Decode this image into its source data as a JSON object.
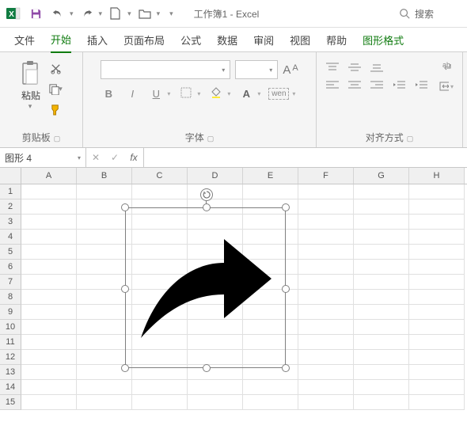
{
  "title": "工作簿1 - Excel",
  "search_placeholder": "搜索",
  "tabs": {
    "file": "文件",
    "home": "开始",
    "insert": "插入",
    "layout": "页面布局",
    "formula": "公式",
    "data": "数据",
    "review": "审阅",
    "view": "视图",
    "help": "帮助",
    "shapeFormat": "图形格式"
  },
  "ribbon": {
    "clipboard": {
      "paste": "粘贴",
      "label": "剪贴板"
    },
    "font": {
      "label": "字体",
      "bold": "B",
      "italic": "I",
      "underline": "U",
      "wen": "wen",
      "A_large": "A",
      "A_small": "A"
    },
    "align": {
      "label": "对齐方式"
    }
  },
  "namebox": "图形 4",
  "formula": "",
  "cols": [
    "A",
    "B",
    "C",
    "D",
    "E",
    "F",
    "G",
    "H"
  ],
  "rows": [
    "1",
    "2",
    "3",
    "4",
    "5",
    "6",
    "7",
    "8",
    "9",
    "10",
    "11",
    "12",
    "13",
    "14",
    "15"
  ]
}
